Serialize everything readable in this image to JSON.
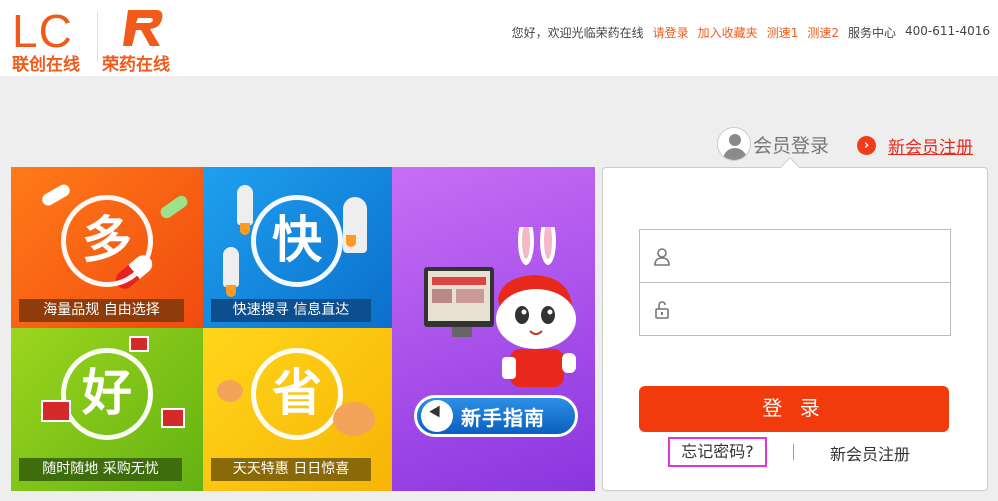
{
  "header": {
    "logo_lc_text": "LC",
    "logo_lc_sub": "联创在线",
    "logo_r_sub": "荣药在线",
    "greeting": "您好，欢迎光临荣药在线",
    "login_link": "请登录",
    "favorite_link": "加入收藏夹",
    "speed1_link": "测速1",
    "speed2_link": "测速2",
    "service_label": "服务中心",
    "phone": "400-611-4016"
  },
  "member": {
    "login_label": "会员登录",
    "register_link": "新会员注册"
  },
  "tiles": {
    "duo": {
      "char": "多",
      "caption": "海量品规 自由选择"
    },
    "kuai": {
      "char": "快",
      "caption": "快速搜寻 信息直达"
    },
    "hao": {
      "char": "好",
      "caption": "随时随地 采购无忧"
    },
    "sheng": {
      "char": "省",
      "caption": "天天特惠 日日惊喜"
    },
    "guide": {
      "button_label": "新手指南"
    }
  },
  "login_panel": {
    "username_value": "",
    "password_value": "",
    "login_button": "登 录",
    "forgot_link": "忘记密码?",
    "register_link": "新会员注册"
  },
  "colors": {
    "brand_orange": "#f05a1a",
    "login_button": "#f23b0d",
    "register_red": "#e8281a"
  },
  "icons": [
    "user-icon",
    "lock-icon",
    "arrow-right-icon",
    "avatar-icon",
    "cursor-icon"
  ]
}
